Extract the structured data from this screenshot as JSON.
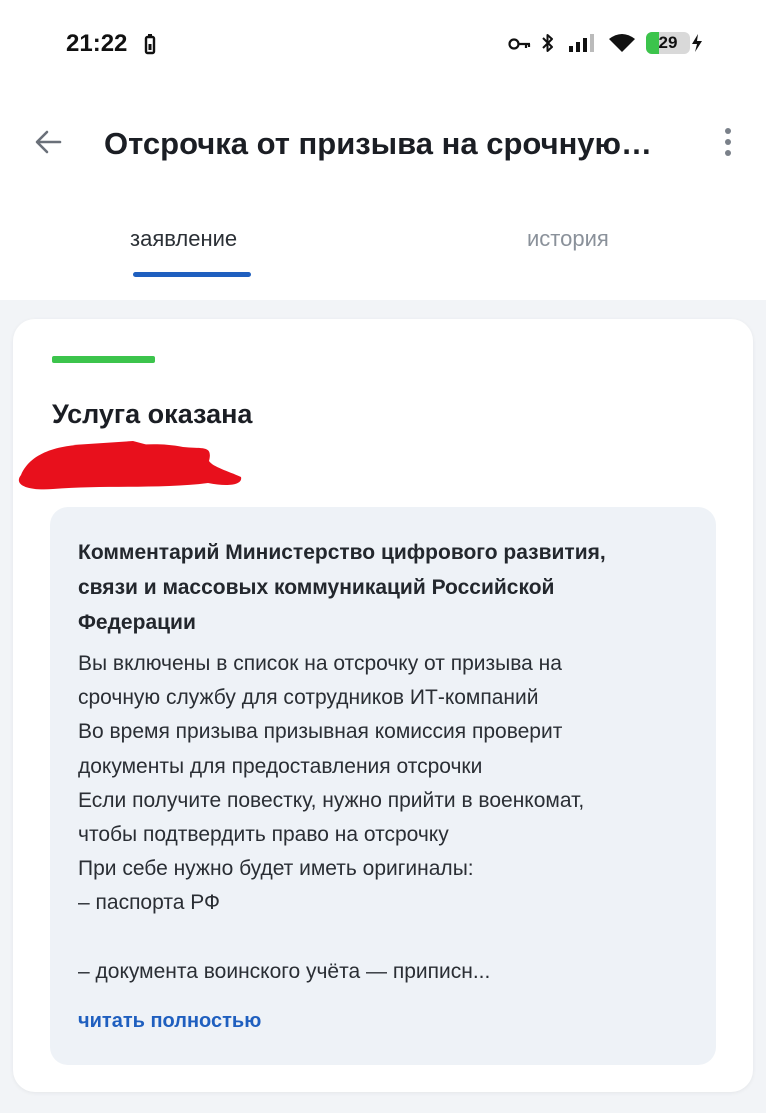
{
  "status_bar": {
    "time": "21:22",
    "battery_level": "29",
    "battery_fraction": 0.29,
    "icons": [
      "battery-saver-icon",
      "key-icon",
      "bluetooth-icon",
      "signal-icon",
      "wifi-icon",
      "charging-bolt-icon"
    ]
  },
  "header": {
    "title": "Отсрочка от призыва на срочную…",
    "back_icon": "arrow-left-icon",
    "more_icon": "more-vertical-icon"
  },
  "tabs": [
    {
      "label": "заявление",
      "active": true
    },
    {
      "label": "история",
      "active": false
    }
  ],
  "card": {
    "status_color": "#3cc44c",
    "status_text": "Услуга оказана",
    "comment": {
      "title": "Комментарий Министерство цифрового развития, связи и массовых коммуникаций Российской Федерации",
      "title_lines": [
        "Комментарий Министерство цифрового развития,",
        "связи и массовых коммуникаций Российской",
        "Федерации"
      ],
      "body_lines": [
        "Вы включены в список на отсрочку от призыва на",
        "срочную службу для сотрудников ИТ-компаний",
        "Во время призыва призывная комиссия проверит",
        "документы для предоставления отсрочки",
        "Если получите повестку, нужно прийти в военкомат,",
        "чтобы подтвердить право на отсрочку",
        "При себе нужно будет иметь оригиналы:",
        "– паспорта РФ",
        "",
        "– документа воинского учёта — приписн..."
      ],
      "read_more": "читать полностью"
    }
  },
  "colors": {
    "accent": "#1f5fbf",
    "success": "#3cc44c",
    "redaction": "#e8101c"
  }
}
